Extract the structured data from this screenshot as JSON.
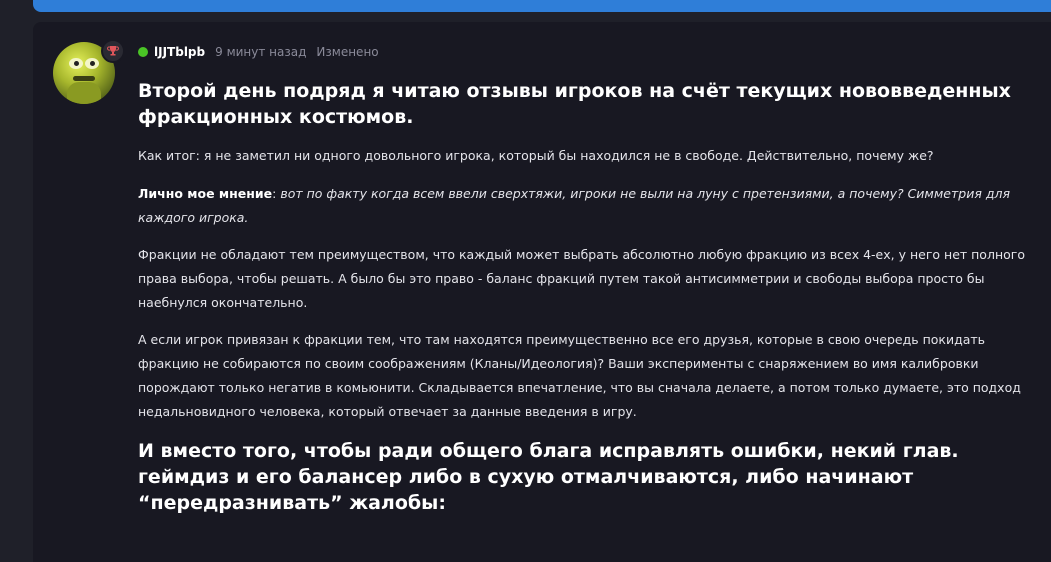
{
  "post": {
    "username": "lJJTblpb",
    "time": "9 минут назад",
    "edited": "Изменено",
    "heading1": "Второй день подряд я читаю отзывы игроков на счёт текущих нововведенных фракционных костюмов.",
    "para1": "Как итог: я не заметил ни одного довольного игрока, который бы находился не в свободе. Действительно, почему же?",
    "para2_bold": "Лично мое мнение",
    "para2_sep": ": ",
    "para2_italic": "вот по факту когда всем ввели сверхтяжи, игроки не выли на луну с претензиями, а почему? Симметрия для каждого игрока.",
    "para3": "Фракции не обладают тем преимуществом, что каждый может выбрать абсолютно любую фракцию из всех 4-ех, у него нет полного права выбора, чтобы решать. А было бы это право - баланс фракций путем такой антисимметрии и свободы выбора просто бы наебнулся окончательно.",
    "para4": "А если игрок привязан к фракции тем, что там находятся преимущественно все его друзья, которые в свою очередь покидать фракцию не собираются по своим соображениям (Кланы/Идеология)? Ваши эксперименты с снаряжением во имя калибровки порождают только негатив в комьюнити. Складывается впечатление, что вы сначала делаете, а потом только думаете, это подход недальновидного человека, который отвечает за данные введения в игру.",
    "heading2": "И вместо того, чтобы ради общего блага исправлять ошибки, некий глав. геймдиз и его балансер либо в сухую отмалчиваются, либо начинают “передразнивать” жалобы:"
  },
  "icons": {
    "avatar": "alien-avatar",
    "badge": "trophy-icon",
    "status": "online-dot"
  },
  "colors": {
    "accent": "#2f7ed8",
    "online": "#4ac426",
    "badge_icon": "#e0565b"
  }
}
